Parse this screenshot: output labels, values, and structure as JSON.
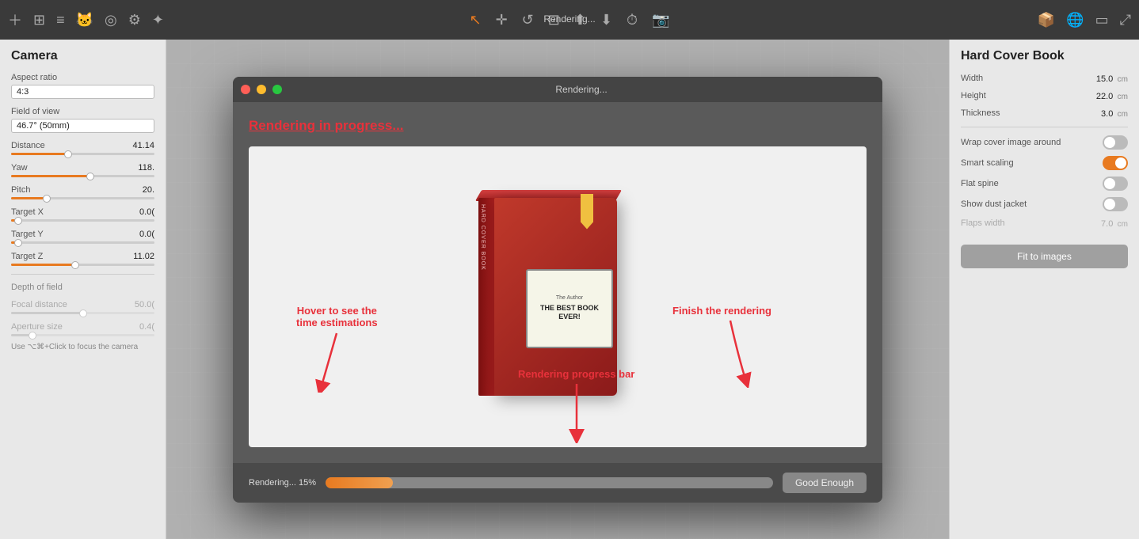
{
  "toolbar": {
    "title": "Rendering...",
    "icons": [
      {
        "name": "add-icon",
        "symbol": "＋"
      },
      {
        "name": "grid-icon",
        "symbol": "⊞"
      },
      {
        "name": "list-icon",
        "symbol": "≡"
      },
      {
        "name": "person-icon",
        "symbol": "🎭"
      },
      {
        "name": "target-icon",
        "symbol": "⊙"
      },
      {
        "name": "settings-icon",
        "symbol": "⚙"
      },
      {
        "name": "sun-icon",
        "symbol": "✦"
      }
    ],
    "center_icons": [
      {
        "name": "cursor-icon",
        "symbol": "↖"
      },
      {
        "name": "move-icon",
        "symbol": "✛"
      },
      {
        "name": "undo-icon",
        "symbol": "↺"
      },
      {
        "name": "crop-icon",
        "symbol": "⊡"
      },
      {
        "name": "export-icon",
        "symbol": "⬆"
      },
      {
        "name": "import-icon",
        "symbol": "⬇"
      },
      {
        "name": "clock-icon",
        "symbol": "⏰"
      },
      {
        "name": "render-icon",
        "symbol": "🎬"
      }
    ],
    "right_icons": [
      {
        "name": "box-icon",
        "symbol": "📦"
      },
      {
        "name": "globe-icon",
        "symbol": "🌐"
      },
      {
        "name": "panel-icon",
        "symbol": "▭"
      },
      {
        "name": "expand-icon",
        "symbol": "⤢"
      }
    ]
  },
  "left_panel": {
    "title": "Camera",
    "aspect_ratio_label": "Aspect ratio",
    "aspect_ratio_value": "4:3",
    "fov_label": "Field of view",
    "fov_value": "46.7° (50mm)",
    "sliders": [
      {
        "label": "Distance",
        "value": "41.14",
        "fill_pct": 40
      },
      {
        "label": "Yaw",
        "value": "118.",
        "fill_pct": 55
      },
      {
        "label": "Pitch",
        "value": "20.",
        "fill_pct": 25
      },
      {
        "label": "Target X",
        "value": "0.0(",
        "fill_pct": 5
      },
      {
        "label": "Target Y",
        "value": "0.0(",
        "fill_pct": 5
      },
      {
        "label": "Target Z",
        "value": "11.02",
        "fill_pct": 45
      }
    ],
    "depth_of_field_label": "Depth of field",
    "dof_sliders": [
      {
        "label": "Focal distance",
        "value": "50.0(",
        "fill_pct": 50
      },
      {
        "label": "Aperture size",
        "value": "0.4(",
        "fill_pct": 15
      }
    ],
    "footer_tip": "Use ⌥⌘+Click to focus the camera"
  },
  "modal": {
    "title": "Rendering...",
    "rendering_header": "Rendering in progress...",
    "book": {
      "author": "The Author",
      "title_line1": "THE BEST BOOK",
      "title_line2": "EVER!"
    },
    "footer": {
      "status_text": "Rendering... 15%",
      "progress_pct": 15,
      "good_enough_label": "Good Enough"
    }
  },
  "annotations": [
    {
      "id": "hover-annotation",
      "text": "Hover to see the\ntime estimations",
      "target": "progress-bar"
    },
    {
      "id": "progress-annotation",
      "text": "Rendering progress bar",
      "target": "progress-bar"
    },
    {
      "id": "finish-annotation",
      "text": "Finish the rendering",
      "target": "good-enough-btn"
    }
  ],
  "right_panel": {
    "title": "Hard Cover Book",
    "properties": [
      {
        "label": "Width",
        "value": "15.0",
        "unit": "cm"
      },
      {
        "label": "Height",
        "value": "22.0",
        "unit": "cm"
      },
      {
        "label": "Thickness",
        "value": "3.0",
        "unit": "cm"
      }
    ],
    "toggles": [
      {
        "label": "Wrap cover image around",
        "state": "off"
      },
      {
        "label": "Smart scaling",
        "state": "on"
      },
      {
        "label": "Flat spine",
        "state": "off"
      },
      {
        "label": "Show dust jacket",
        "state": "off"
      }
    ],
    "flaps_width_label": "Flaps width",
    "flaps_width_value": "7.0",
    "flaps_width_unit": "cm",
    "fit_to_images_label": "Fit to images"
  }
}
